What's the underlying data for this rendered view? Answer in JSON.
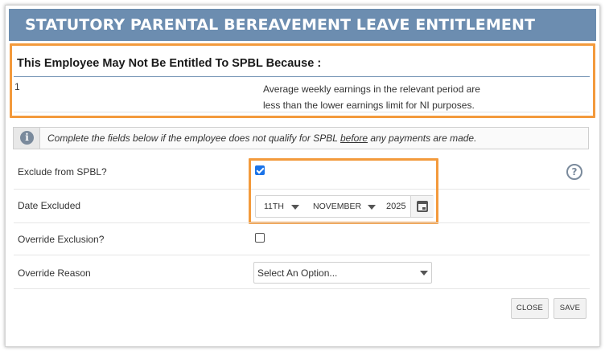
{
  "dialog": {
    "title": "STATUTORY PARENTAL BEREAVEMENT LEAVE ENTITLEMENT"
  },
  "reasons": {
    "heading": "This Employee May Not Be Entitled To SPBL Because :",
    "items": [
      {
        "number": "1",
        "line1": "Average weekly earnings in the relevant period are",
        "line2": "less than the lower earnings limit for NI purposes."
      }
    ]
  },
  "info": {
    "icon": "info-icon",
    "text_before": "Complete the fields below if the employee does not qualify for SPBL ",
    "text_underlined": "before",
    "text_after": " any payments are made."
  },
  "form": {
    "exclude": {
      "label": "Exclude from SPBL?",
      "checked": true
    },
    "date_excluded": {
      "label": "Date Excluded",
      "day": "11TH",
      "month": "NOVEMBER",
      "year": "2025",
      "calendar_icon": "calendar-icon"
    },
    "override_exclusion": {
      "label": "Override Exclusion?",
      "checked": false
    },
    "override_reason": {
      "label": "Override Reason",
      "value": "Select An Option..."
    },
    "help_icon": "help-icon"
  },
  "buttons": {
    "close": "CLOSE",
    "save": "SAVE"
  },
  "colors": {
    "titlebar": "#6c8db0",
    "highlight": "#f39a3c",
    "checkbox_checked": "#1a73e8"
  }
}
